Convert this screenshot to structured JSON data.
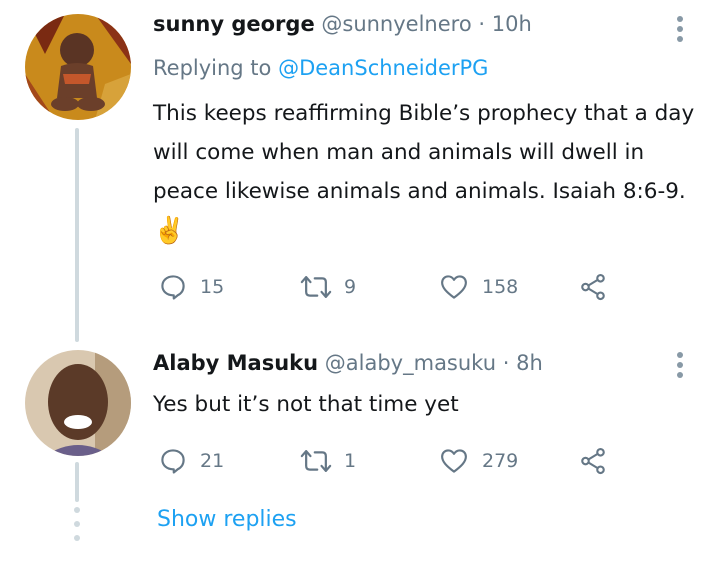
{
  "tweet1": {
    "display_name": "sunny george",
    "handle": "@sunnyelnero",
    "separator": "·",
    "time": "10h",
    "replying_prefix": "Replying to",
    "replying_handle": "@DeanSchneiderPG",
    "text_lines": [
      "This keeps reaffirming Bible’s prophecy that a day",
      "will come when man and animals will dwell in",
      "peace likewise animals and animals. Isaiah 8:6-9."
    ],
    "emoji": "✌️",
    "replies": "15",
    "retweets": "9",
    "likes": "158"
  },
  "tweet2": {
    "display_name": "Alaby Masuku",
    "handle": "@alaby_masuku",
    "separator": "·",
    "time": "8h",
    "text": "Yes but it’s not that time yet",
    "replies": "21",
    "retweets": "1",
    "likes": "279"
  },
  "show_replies_label": "Show replies",
  "colors": {
    "link": "#1da1f2",
    "muted": "#657786",
    "thread_line": "#cfd9de"
  }
}
